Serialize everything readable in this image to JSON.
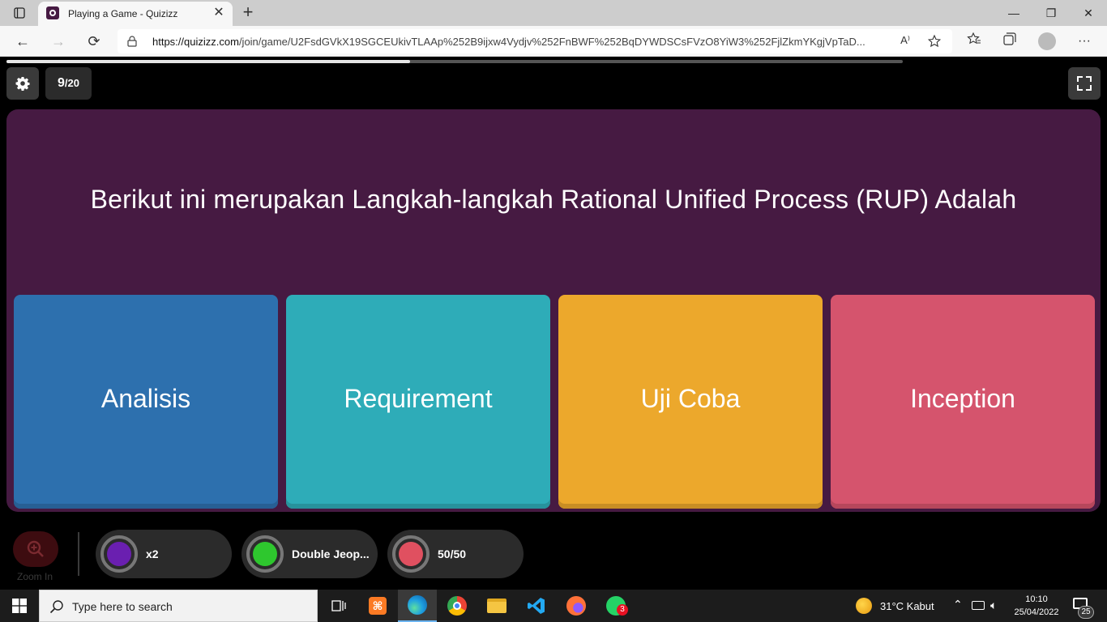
{
  "browser": {
    "tab_title": "Playing a Game - Quizizz",
    "tab_close": "✕",
    "new_tab": "+",
    "minimize": "—",
    "restore": "❐",
    "close": "✕",
    "url_domain": "https://quizizz.com",
    "url_path": "/join/game/U2FsdGVkX19SGCEUkivTLAAp%252B9ijxw4Vydjv%252FnBWF%252BqDYWDSCsFVzO8YiW3%252FjlZkmYKgjVpTaD...",
    "read_aloud_label": "A⁾",
    "back": "←",
    "forward": "→",
    "refresh": "⟳",
    "menu": "···"
  },
  "game": {
    "question_current": "9",
    "question_total": "/20",
    "progress": 0.45,
    "question_text": "Berikut ini merupakan Langkah-langkah Rational Unified Process (RUP) Adalah",
    "options": [
      {
        "label": "Analisis",
        "color": "#2d70ae",
        "shade": "#275f94"
      },
      {
        "label": "Requirement",
        "color": "#2eacb8",
        "shade": "#27929c"
      },
      {
        "label": "Uji Coba",
        "color": "#eca82c",
        "shade": "#c88d24"
      },
      {
        "label": "Inception",
        "color": "#d5546d",
        "shade": "#b6475c"
      }
    ],
    "zoom_label": "Zoom In",
    "powerups": [
      {
        "label": "x2",
        "color": "#6a1fb0"
      },
      {
        "label": "Double Jeop...",
        "color": "#2ec72e"
      },
      {
        "label": "50/50",
        "color": "#e05060"
      }
    ]
  },
  "taskbar": {
    "search_placeholder": "Type here to search",
    "weather": "31°C  Kabut",
    "time": "10:10",
    "date": "25/04/2022",
    "notification_count": "25",
    "whatsapp_badge": "3"
  }
}
